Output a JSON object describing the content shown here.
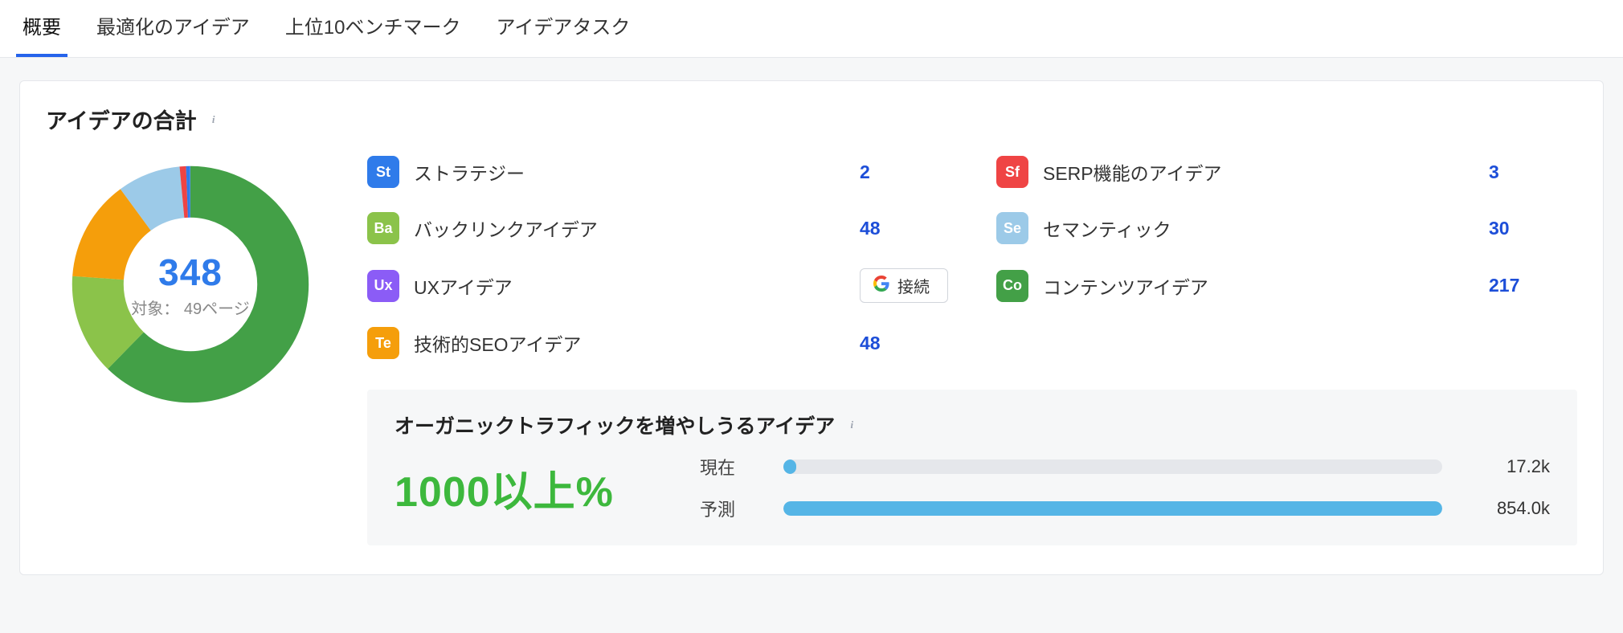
{
  "tabs": [
    "概要",
    "最適化のアイデア",
    "上位10ベンチマーク",
    "アイデアタスク"
  ],
  "active_tab": 0,
  "card": {
    "title": "アイデアの合計"
  },
  "donut": {
    "total": "348",
    "subtitle": "対象： 49ページ"
  },
  "ideas_left": [
    {
      "code": "St",
      "color": "#2f7bea",
      "label": "ストラテジー",
      "value": "2"
    },
    {
      "code": "Ba",
      "color": "#8bc34a",
      "label": "バックリンクアイデア",
      "value": "48"
    },
    {
      "code": "Ux",
      "color": "#8b5cf6",
      "label": "UXアイデア",
      "value": "__connect__"
    },
    {
      "code": "Te",
      "color": "#f59e0b",
      "label": "技術的SEOアイデア",
      "value": "48"
    }
  ],
  "ideas_right": [
    {
      "code": "Sf",
      "color": "#ef4444",
      "label": "SERP機能のアイデア",
      "value": "3"
    },
    {
      "code": "Se",
      "color": "#9ccae8",
      "label": "セマンティック",
      "value": "30"
    },
    {
      "code": "Co",
      "color": "#43a047",
      "label": "コンテンツアイデア",
      "value": "217"
    }
  ],
  "connect_button": {
    "label": "接続"
  },
  "traffic": {
    "title": "オーガニックトラフィックを増やしうるアイデア",
    "percent": "1000以上%",
    "rows": [
      {
        "label": "現在",
        "value": "17.2k",
        "fill_pct": 2
      },
      {
        "label": "予測",
        "value": "854.0k",
        "fill_pct": 100
      }
    ]
  },
  "chart_data": [
    {
      "type": "pie",
      "title": "アイデアの合計",
      "categories": [
        "コンテンツアイデア",
        "バックリンクアイデア",
        "技術的SEOアイデア",
        "セマンティック",
        "SERP機能のアイデア",
        "ストラテジー"
      ],
      "values": [
        217,
        48,
        48,
        30,
        3,
        2
      ],
      "colors": [
        "#43a047",
        "#8bc34a",
        "#f59e0b",
        "#9ccae8",
        "#ef4444",
        "#2f7bea"
      ],
      "total": 348,
      "subtitle": "対象： 49ページ"
    },
    {
      "type": "bar",
      "title": "オーガニックトラフィックを増やしうるアイデア",
      "categories": [
        "現在",
        "予測"
      ],
      "values": [
        17200,
        854000
      ],
      "annotations": [
        "17.2k",
        "854.0k"
      ],
      "percent_increase_label": "1000以上%"
    }
  ]
}
